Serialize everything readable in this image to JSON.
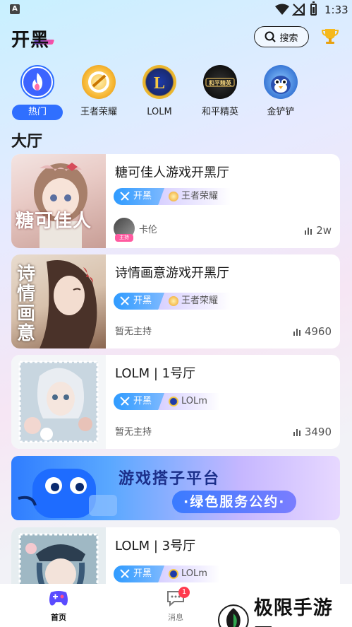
{
  "status_bar": {
    "notification_icon": "A",
    "time": "1:33"
  },
  "header": {
    "logo": "开黑",
    "search_label": "搜索"
  },
  "categories": [
    {
      "label": "热门",
      "icon": "flame-icon",
      "active": true
    },
    {
      "label": "王者荣耀",
      "icon": "honor-of-kings-icon"
    },
    {
      "label": "LOLM",
      "icon": "lolm-icon"
    },
    {
      "label": "和平精英",
      "icon": "peace-elite-icon"
    },
    {
      "label": "金铲铲",
      "icon": "golden-spatula-icon"
    }
  ],
  "section_title": "大厅",
  "rooms": [
    {
      "title": "糖可佳人游戏开黑厅",
      "type_tag": "开黑",
      "game_tag": "王者荣耀",
      "host": "卡伦",
      "host_badge": "主持",
      "count": "2w",
      "thumb_text": "糖可佳人"
    },
    {
      "title": "诗情画意游戏开黑厅",
      "type_tag": "开黑",
      "game_tag": "王者荣耀",
      "host": "暂无主持",
      "count": "4960",
      "thumb_text": "诗情画意"
    },
    {
      "title": "LOLM | 1号厅",
      "type_tag": "开黑",
      "game_tag": "LOLm",
      "host": "暂无主持",
      "count": "3490"
    },
    {
      "title": "LOLM | 3号厅",
      "type_tag": "开黑",
      "game_tag": "LOLm"
    }
  ],
  "banner": {
    "title": "游戏搭子平台",
    "pill": "·绿色服务公约·"
  },
  "bottom_nav": [
    {
      "label": "首页",
      "active": true
    },
    {
      "label": "消息",
      "badge": "1"
    }
  ],
  "watermark": "极限手游网",
  "colors": {
    "accent": "#2f6fff",
    "badge": "#ff3b4e"
  }
}
